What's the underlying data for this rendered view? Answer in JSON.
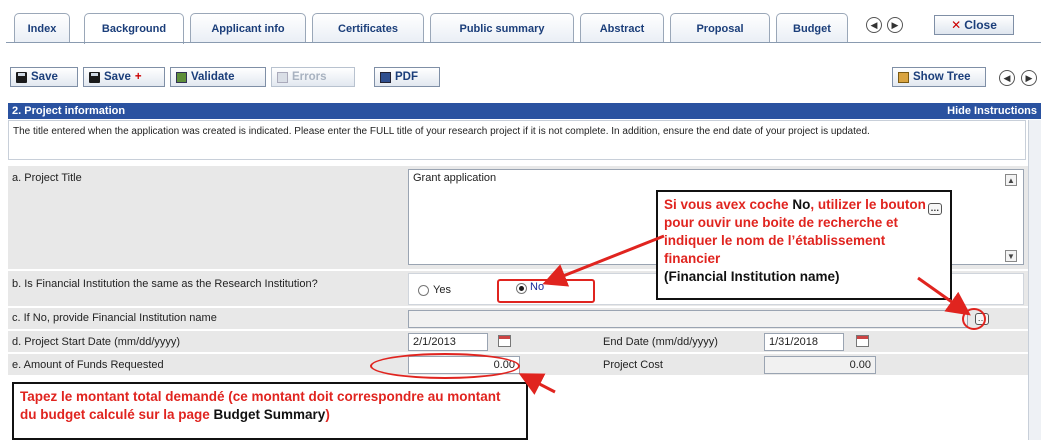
{
  "tabs": [
    {
      "label": "Index"
    },
    {
      "label": "Background"
    },
    {
      "label": "Applicant info"
    },
    {
      "label": "Certificates"
    },
    {
      "label": "Public summary"
    },
    {
      "label": "Abstract"
    },
    {
      "label": "Proposal"
    },
    {
      "label": "Budget"
    }
  ],
  "close_label": "Close",
  "toolbar": {
    "save": "Save",
    "save_plus": "Save",
    "validate": "Validate",
    "errors": "Errors",
    "pdf": "PDF",
    "show_tree": "Show Tree"
  },
  "section": {
    "title": "2. Project information",
    "hide_instructions": "Hide Instructions",
    "instructions": "The title entered when the application was created is indicated. Please enter the FULL title of your research project if it is not complete. In addition, ensure the end date of your project is updated."
  },
  "form": {
    "a_label": "a. Project Title",
    "a_value": "Grant application",
    "b_label": "b. Is Financial Institution the same as the Research Institution?",
    "b_yes": "Yes",
    "b_no": "No",
    "b_selected": "No",
    "c_label": "c. If No, provide Financial Institution name",
    "c_value": "",
    "d_label": "d. Project Start Date (mm/dd/yyyy)",
    "d_value": "2/1/2013",
    "end_label": "End Date (mm/dd/yyyy)",
    "end_value": "1/31/2018",
    "e_label": "e. Amount of Funds Requested",
    "e_value": "0.00",
    "cost_label": "Project Cost",
    "cost_value": "0.00"
  },
  "annotations": {
    "callout1_p1": "Si vous avex coche ",
    "callout1_no": "No",
    "callout1_p2": ", utilizer le bouton",
    "callout1_p3": " pour ouvir une boite de recherche et indiquer le nom de l’établissement financier",
    "callout1_p4": "(Financial Institution name)",
    "callout2_p1": "Tapez le montant total demandé (ce montant doit correspondre au montant du budget calculé sur la page ",
    "callout2_p2": "Budget Summary",
    "callout2_p3": ")"
  },
  "colors": {
    "section_header": "#2a52a0",
    "annotation_red": "#e0241f",
    "row_bg": "#e8e8e8"
  }
}
